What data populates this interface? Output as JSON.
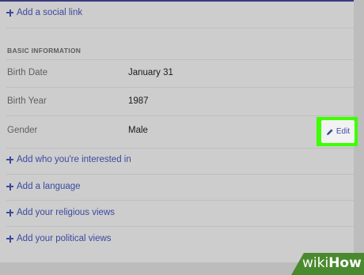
{
  "profile": {
    "add_social_link": "Add a social link",
    "section_heading": "BASIC INFORMATION",
    "rows": [
      {
        "label": "Birth Date",
        "value": "January 31"
      },
      {
        "label": "Birth Year",
        "value": "1987"
      },
      {
        "label": "Gender",
        "value": "Male"
      }
    ],
    "edit_label": "Edit",
    "add_links": [
      "Add who you're interested in",
      "Add a language",
      "Add your religious views",
      "Add your political views"
    ]
  },
  "watermark": {
    "wiki": "wiki",
    "how": "How"
  },
  "colors": {
    "highlight": "#3cff00",
    "link": "#3b4aa0"
  },
  "icons": [
    "plus-icon",
    "pencil-icon"
  ]
}
